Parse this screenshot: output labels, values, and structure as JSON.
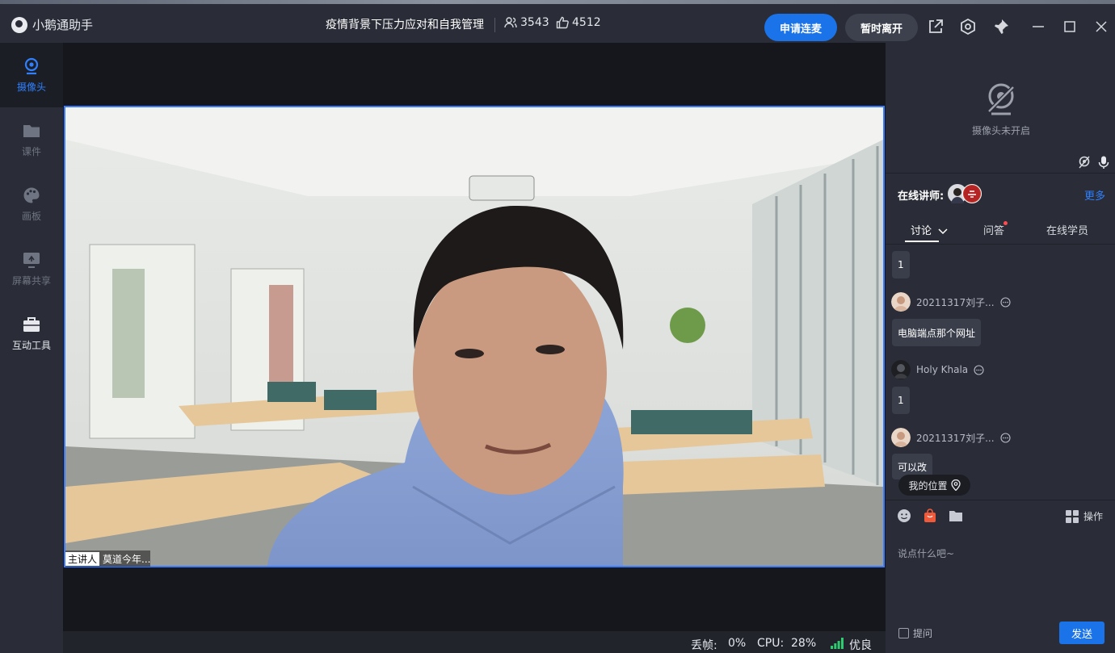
{
  "app": {
    "name": "小鹅通助手"
  },
  "header": {
    "title": "疫情背景下压力应对和自我管理",
    "viewers": "3543",
    "likes": "4512",
    "apply_mic_label": "申请连麦",
    "leave_label": "暂时离开"
  },
  "sidebar": {
    "items": [
      {
        "label": "摄像头",
        "icon": "camera-icon"
      },
      {
        "label": "课件",
        "icon": "folder-icon"
      },
      {
        "label": "画板",
        "icon": "palette-icon"
      },
      {
        "label": "屏幕共享",
        "icon": "screen-share-icon"
      },
      {
        "label": "互动工具",
        "icon": "toolbox-icon"
      }
    ]
  },
  "video": {
    "role_tag": "主讲人",
    "speaker_name": "莫道今年..."
  },
  "status": {
    "frame_loss_label": "丢帧:",
    "frame_loss_value": "0%",
    "cpu_label": "CPU:",
    "cpu_value": "28%",
    "network_label": "优良"
  },
  "right_panel": {
    "camera_off_label": "摄像头未开启",
    "lecturers_label": "在线讲师:",
    "more_label": "更多",
    "tabs": [
      "讨论",
      "问答",
      "在线学员"
    ],
    "messages": [
      {
        "user": "",
        "text": "1"
      },
      {
        "user": "20211317刘子...",
        "text": "电脑端点那个网址"
      },
      {
        "user": "Holy Khala",
        "text": "1"
      },
      {
        "user": "20211317刘子...",
        "text": "可以改"
      }
    ],
    "location_label": "我的位置",
    "operation_label": "操作",
    "input_placeholder": "说点什么吧~",
    "ask_label": "提问",
    "send_label": "发送"
  },
  "colors": {
    "accent": "#1a73e8",
    "panel": "#2a2d37",
    "stage": "#16171d"
  }
}
